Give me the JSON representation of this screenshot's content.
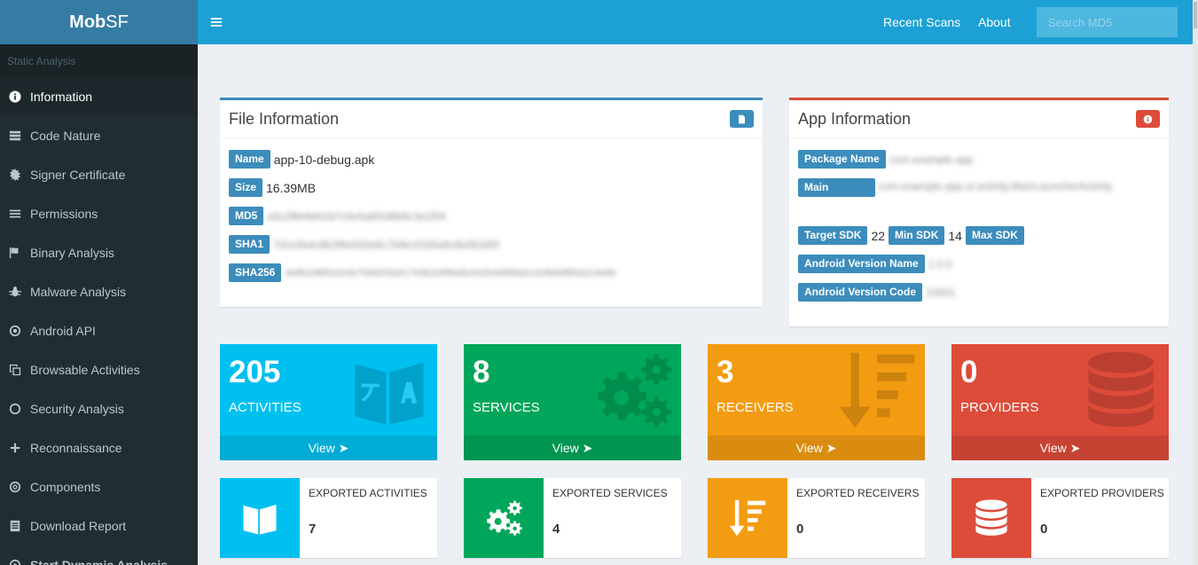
{
  "app": {
    "logo_bold": "Mob",
    "logo_rest": "SF"
  },
  "sidebar": {
    "section": "Static Analysis",
    "items": [
      {
        "label": "Information",
        "icon": "info-icon"
      },
      {
        "label": "Code Nature",
        "icon": "server-icon"
      },
      {
        "label": "Signer Certificate",
        "icon": "certificate-icon"
      },
      {
        "label": "Permissions",
        "icon": "list-icon"
      },
      {
        "label": "Binary Analysis",
        "icon": "flag-icon"
      },
      {
        "label": "Malware Analysis",
        "icon": "bug-icon"
      },
      {
        "label": "Android API",
        "icon": "dot-circle-icon"
      },
      {
        "label": "Browsable Activities",
        "icon": "clone-icon"
      },
      {
        "label": "Security Analysis",
        "icon": "circle-icon"
      },
      {
        "label": "Reconnaissance",
        "icon": "plus-icon"
      },
      {
        "label": "Components",
        "icon": "bullseye-icon"
      },
      {
        "label": "Download Report",
        "icon": "file-icon"
      },
      {
        "label": "Start Dynamic Analysis",
        "icon": "play-circle-icon"
      }
    ]
  },
  "header": {
    "recent_scans": "Recent Scans",
    "about": "About",
    "search_placeholder": "Search MD5"
  },
  "file_info": {
    "title": "File Information",
    "name_label": "Name",
    "name_value": "app-10-debug.apk",
    "size_label": "Size",
    "size_value": "16.39MB",
    "md5_label": "MD5",
    "md5_value": "a3c2f8e9d41b7c0e5a6f2d8b9c3e1f04",
    "sha1_label": "SHA1",
    "sha1_value": "7d1e9a4c8b2f6e0d3a5c7b9e1f2d4a6c8e0b3d5f",
    "sha256_label": "SHA256",
    "sha256_value": "4e8b2d6f0a3c5e7b9d1f3a5c7e9b2d4f6a8c0e2b4d6f8a0c2e4b6d8f0a2c4e6b"
  },
  "app_info": {
    "title": "App Information",
    "package_label": "Package Name",
    "package_value": "com.example.app",
    "main_activity_label": "Main Activity",
    "main_activity_value": "com.example.app.ui.activity.MainLauncherActivity",
    "target_sdk_label": "Target SDK",
    "target_sdk_value": "22",
    "min_sdk_label": "Min SDK",
    "min_sdk_value": "14",
    "max_sdk_label": "Max SDK",
    "version_name_label": "Android Version Name",
    "version_name_value": "1.0.0",
    "version_code_label": "Android Version Code",
    "version_code_value": "10001"
  },
  "tiles": [
    {
      "count": "205",
      "name": "ACTIVITIES",
      "view": "View",
      "color": "#00c0ef",
      "icon": "language-icon"
    },
    {
      "count": "8",
      "name": "SERVICES",
      "view": "View",
      "color": "#00a65a",
      "icon": "cogs-icon"
    },
    {
      "count": "3",
      "name": "RECEIVERS",
      "view": "View",
      "color": "#f39c12",
      "icon": "sort-amount-down-icon"
    },
    {
      "count": "0",
      "name": "PROVIDERS",
      "view": "View",
      "color": "#dd4b39",
      "icon": "database-icon"
    }
  ],
  "exported": [
    {
      "label": "EXPORTED ACTIVITIES",
      "count": "7",
      "color": "#00c0ef",
      "icon": "language-icon"
    },
    {
      "label": "EXPORTED SERVICES",
      "count": "4",
      "color": "#00a65a",
      "icon": "cogs-icon"
    },
    {
      "label": "EXPORTED RECEIVERS",
      "count": "0",
      "color": "#f39c12",
      "icon": "sort-amount-down-icon"
    },
    {
      "label": "EXPORTED PROVIDERS",
      "count": "0",
      "color": "#dd4b39",
      "icon": "database-icon"
    }
  ]
}
